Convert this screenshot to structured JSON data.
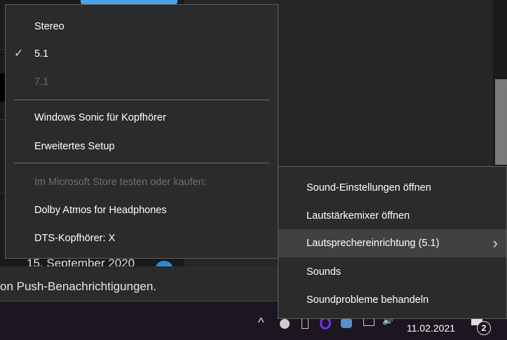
{
  "background": {
    "date": "15. September 2020",
    "notification_text": "on Push-Benachrichtigungen."
  },
  "submenu": {
    "items": [
      {
        "label": "Stereo"
      },
      {
        "label": "5.1",
        "checked": true
      },
      {
        "label": "7.1",
        "disabled": true
      },
      {
        "label": "Windows Sonic für Kopfhörer"
      },
      {
        "label": "Erweitertes Setup"
      },
      {
        "label": "Im Microsoft Store testen oder kaufen:",
        "disabled": true
      },
      {
        "label": "Dolby Atmos for Headphones"
      },
      {
        "label": "DTS-Kopfhörer: X"
      }
    ]
  },
  "context_menu": {
    "items": [
      {
        "label": "Sound-Einstellungen öffnen"
      },
      {
        "label": "Lautstärkemixer öffnen"
      },
      {
        "label": "Lautsprechereinrichtung (5.1)",
        "highlighted": true
      },
      {
        "label": "Sounds"
      },
      {
        "label": "Soundprobleme behandeln"
      }
    ]
  },
  "taskbar": {
    "date": "11.02.2021",
    "notification_count": "2"
  },
  "icons": {
    "check": "✓",
    "chevron_right": "›",
    "chevron_up": "^"
  }
}
